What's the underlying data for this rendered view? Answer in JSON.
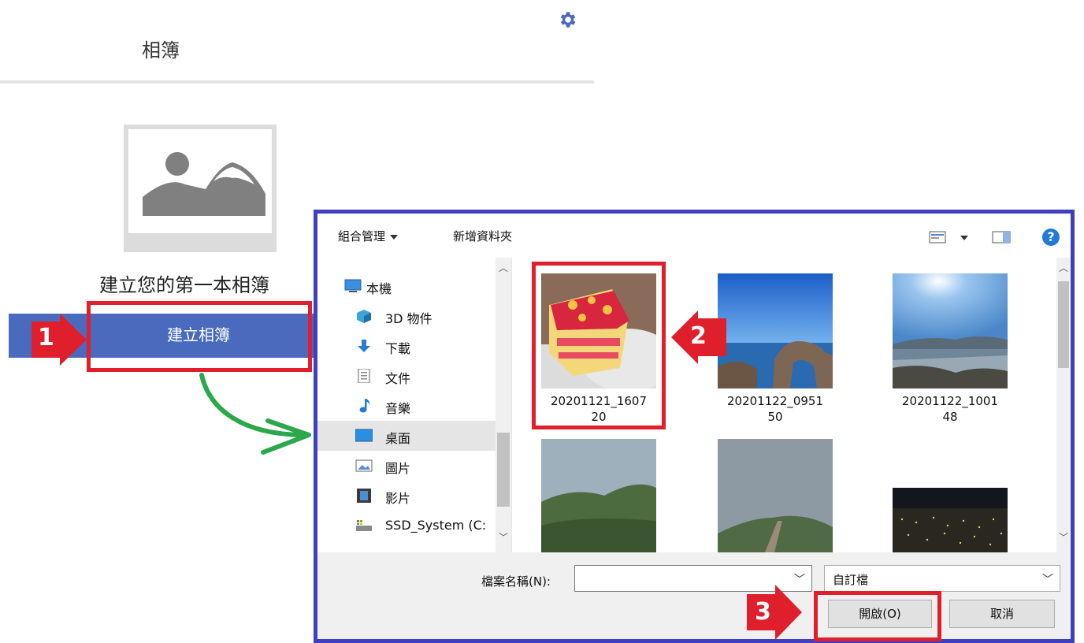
{
  "app": {
    "header_title": "相簿",
    "empty_state_text": "建立您的第一本相簿",
    "create_button_label": "建立相簿"
  },
  "callouts": [
    "1",
    "2",
    "3"
  ],
  "dialog": {
    "toolbar": {
      "organize_label": "組合管理",
      "new_folder_label": "新增資料夾",
      "help_label": "?"
    },
    "nav_items": [
      {
        "label": "本機",
        "icon": "computer-icon"
      },
      {
        "label": "3D 物件",
        "icon": "3d-objects-icon"
      },
      {
        "label": "下載",
        "icon": "download-icon"
      },
      {
        "label": "文件",
        "icon": "document-icon"
      },
      {
        "label": "音樂",
        "icon": "music-icon"
      },
      {
        "label": "桌面",
        "icon": "desktop-icon",
        "selected": true
      },
      {
        "label": "圖片",
        "icon": "pictures-icon"
      },
      {
        "label": "影片",
        "icon": "videos-icon"
      },
      {
        "label": "SSD_System (C:",
        "icon": "drive-icon"
      }
    ],
    "files": [
      {
        "name_line1": "20201121_1607",
        "name_line2": "20"
      },
      {
        "name_line1": "20201122_0951",
        "name_line2": "50"
      },
      {
        "name_line1": "20201122_1001",
        "name_line2": "48"
      },
      {
        "name_line1": "",
        "name_line2": ""
      },
      {
        "name_line1": "",
        "name_line2": ""
      },
      {
        "name_line1": "",
        "name_line2": ""
      }
    ],
    "filename_label": "檔案名稱(N):",
    "filename_value": "",
    "filetype_value": "自訂檔",
    "open_button_label": "開啟(O)",
    "cancel_button_label": "取消"
  },
  "colors": {
    "accent_blue": "#4a6bbd",
    "highlight_red": "#e01f2c",
    "dialog_border": "#3f3fc0",
    "arrow_green": "#2aa84a"
  }
}
